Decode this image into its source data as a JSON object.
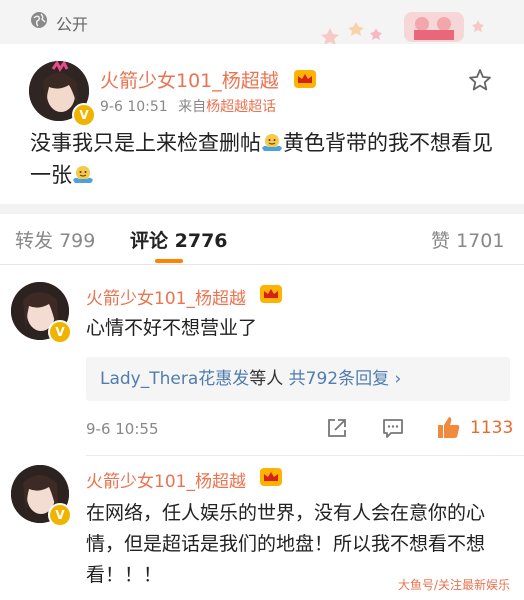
{
  "header": {
    "visibility": "公开"
  },
  "post": {
    "author": "火箭少女101_杨超越",
    "time": "9-6 10:51",
    "source_prefix": "来自",
    "source": "杨超越超话",
    "text_part1": "没事我只是上来检查删帖",
    "text_part2": "黄色背带的我不想看见一张"
  },
  "tabs": {
    "repost_label": "转发",
    "repost_count": "799",
    "comment_label": "评论",
    "comment_count": "2776",
    "like_label": "赞",
    "like_count": "1701"
  },
  "comments": [
    {
      "author": "火箭少女101_杨超越",
      "text": "心情不好不想营业了",
      "reply_who": "Lady_Thera花惠发",
      "reply_mid": "等人 ",
      "reply_count": "共792条回复 ›",
      "time": "9-6 10:55",
      "likes": "1133"
    },
    {
      "author": "火箭少女101_杨超越",
      "text": "在网络，任人娱乐的世界，没有人会在意你的心情，但是超话是我们的地盘！所以我不想看不想看！！！"
    }
  ],
  "watermark": "大鱼号/关注最新娱乐"
}
